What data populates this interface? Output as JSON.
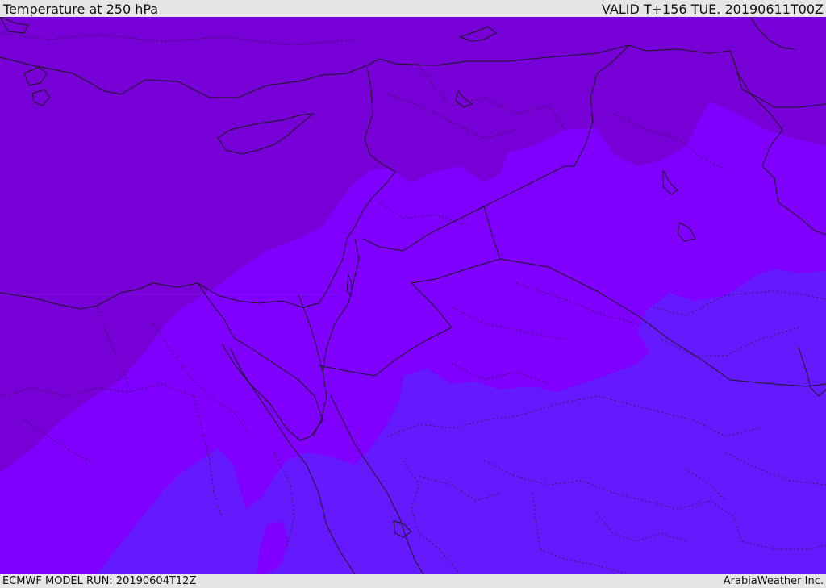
{
  "header": {
    "title": "Temperature at 250 hPa",
    "valid": "VALID T+156 TUE. 20190611T00Z"
  },
  "footer": {
    "model_run": "ECMWF MODEL RUN: 20190604T12Z",
    "credit": "ArabiaWeather Inc."
  },
  "map": {
    "region": "Middle East",
    "field": "temperature",
    "colors": {
      "coldest_band": "#7700d6",
      "mid_band": "#7f00ff",
      "warm_band": "#6419ff",
      "deep_purple": "#6e00c4",
      "coast_line": "#1a1a1a"
    }
  }
}
